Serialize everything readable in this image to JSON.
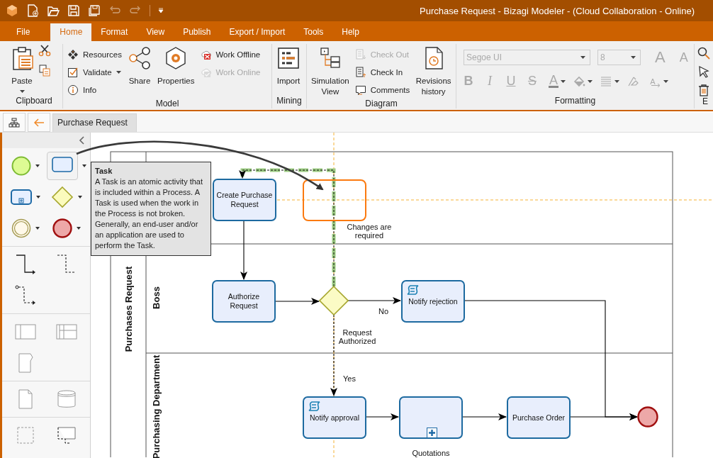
{
  "window": {
    "title": "Purchase Request - Bizagi Modeler - (Cloud Collaboration - Online)"
  },
  "quick_access": [
    {
      "disabled": false
    },
    {
      "disabled": false
    },
    {
      "disabled": false
    },
    {
      "disabled": false
    },
    {
      "disabled": false
    },
    {
      "disabled": true
    },
    {
      "disabled": true
    }
  ],
  "menu_tabs": [
    {
      "label": "File",
      "selected": false
    },
    {
      "label": "Home",
      "selected": true
    },
    {
      "label": "Format",
      "selected": false
    },
    {
      "label": "View",
      "selected": false
    },
    {
      "label": "Publish",
      "selected": false
    },
    {
      "label": "Export / Import",
      "selected": false
    },
    {
      "label": "Tools",
      "selected": false
    },
    {
      "label": "Help",
      "selected": false
    }
  ],
  "ribbon": {
    "groups": [
      {
        "label": "Clipboard",
        "columns": [
          {
            "kind": "large",
            "label": "Paste",
            "dropdown": true
          },
          {
            "kind": "icons"
          }
        ]
      },
      {
        "label": "Model",
        "columns": [
          {
            "kind": "stack",
            "items": [
              {
                "label": "Resources",
                "dropdown": false,
                "disabled": false
              },
              {
                "label": "Validate",
                "dropdown": true,
                "disabled": false
              },
              {
                "label": "Info",
                "dropdown": false,
                "disabled": false
              }
            ]
          },
          {
            "kind": "large",
            "label": "Share",
            "dropdown": false
          },
          {
            "kind": "large",
            "label": "Properties",
            "dropdown": false
          },
          {
            "kind": "stack",
            "items": [
              {
                "label": "Work Offline",
                "dropdown": false,
                "disabled": false
              },
              {
                "label": "Work Online",
                "dropdown": false,
                "disabled": true
              }
            ]
          }
        ]
      },
      {
        "label": "Mining",
        "columns": [
          {
            "kind": "large",
            "label": "Import",
            "dropdown": false
          }
        ]
      },
      {
        "label": "Diagram",
        "columns": [
          {
            "kind": "large",
            "label": "Simulation View",
            "dropdown": false
          },
          {
            "kind": "stack",
            "items": [
              {
                "label": "Check Out",
                "dropdown": false,
                "disabled": true
              },
              {
                "label": "Check In",
                "dropdown": false,
                "disabled": false
              },
              {
                "label": "Comments",
                "dropdown": false,
                "disabled": false
              }
            ]
          },
          {
            "kind": "large",
            "label": "Revisions history",
            "dropdown": false
          }
        ]
      },
      {
        "label": "Formatting",
        "columns": [
          {
            "kind": "format",
            "disabled": true,
            "font": "Segoe UI",
            "size": "8",
            "size_buttons": [
              "A",
              "A"
            ],
            "tools": [
              {
                "kind": "glyph",
                "label": "B",
                "dropdown": false
              },
              {
                "kind": "glyph",
                "label": "I",
                "dropdown": false
              },
              {
                "kind": "glyph",
                "label": "U",
                "dropdown": false
              },
              {
                "kind": "glyph",
                "label": "S",
                "dropdown": false
              },
              {
                "kind": "color",
                "label": "A",
                "dropdown": true
              },
              {
                "kind": "icon",
                "dropdown": true
              },
              {
                "kind": "icon",
                "dropdown": true
              },
              {
                "kind": "icon",
                "dropdown": false
              },
              {
                "kind": "arrow",
                "label": "A",
                "dropdown": true
              }
            ]
          }
        ]
      },
      {
        "label": "E",
        "columns": [
          {
            "kind": "icons"
          }
        ]
      }
    ]
  },
  "document_tabs": [
    {
      "label": "Purchase Request",
      "selected": true
    }
  ],
  "tooltip": {
    "title": "Task",
    "text": "A Task is an atomic activity that is included within a Process. A Task is used when the work in the Process is not broken. Generally, an end-user and/or an application are used to perform the Task."
  },
  "diagram": {
    "pool": "Purchases Request",
    "lanes": [
      "Boss",
      "Purchasing Department"
    ],
    "nodes": [
      {
        "kind": "task",
        "label": "Create Purchase Request"
      },
      {
        "kind": "placeholder"
      },
      {
        "kind": "task",
        "label": "Authorize Request"
      },
      {
        "kind": "gateway"
      },
      {
        "kind": "script",
        "label": "Notify rejection"
      },
      {
        "kind": "script",
        "label": "Notify approval"
      },
      {
        "kind": "subprocess",
        "label": "Quotations"
      },
      {
        "kind": "task",
        "label": "Purchase Order"
      },
      {
        "kind": "end"
      }
    ],
    "flow_labels": [
      "Changes are required",
      "No",
      "Request Authorized",
      "Yes"
    ]
  }
}
